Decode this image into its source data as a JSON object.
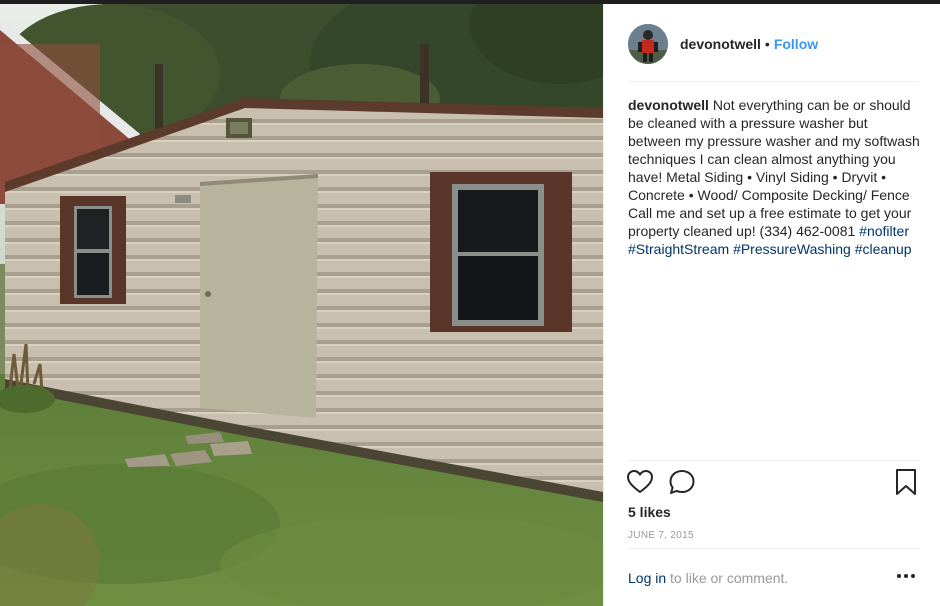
{
  "post": {
    "username": "devonotwell",
    "separator": "•",
    "follow_label": "Follow",
    "caption_user": "devonotwell",
    "caption_text": "Not everything can be or should be cleaned with a pressure washer but between my pressure washer and my softwash techniques I can clean almost anything you have! Metal Siding • Vinyl Siding • Dryvit • Concrete • Wood/ Composite Decking/ Fence Call me and set up a free estimate to get your property cleaned up! (334) 462-0081",
    "hashtags": [
      "#nofilter",
      "#StraightStream",
      "#PressureWashing",
      "#cleanup"
    ],
    "likes": "5 likes",
    "date": "JUNE 7, 2015",
    "login_link": "Log in",
    "login_suffix": " to like or comment."
  },
  "icons": {
    "like": "heart-icon",
    "comment": "comment-icon",
    "save": "bookmark-icon",
    "more": "more-options-icon"
  },
  "colors": {
    "link_blue": "#3897f0",
    "hashtag": "#003569",
    "text": "#262626",
    "muted": "#999999",
    "divider": "#efefef"
  }
}
